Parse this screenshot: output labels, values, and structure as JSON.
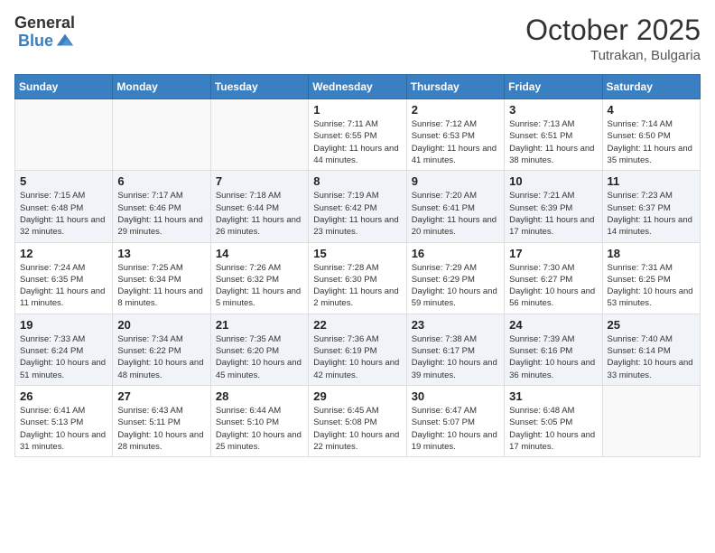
{
  "header": {
    "logo_general": "General",
    "logo_blue": "Blue",
    "month": "October 2025",
    "location": "Tutrakan, Bulgaria"
  },
  "days_of_week": [
    "Sunday",
    "Monday",
    "Tuesday",
    "Wednesday",
    "Thursday",
    "Friday",
    "Saturday"
  ],
  "weeks": [
    [
      {
        "day": "",
        "info": ""
      },
      {
        "day": "",
        "info": ""
      },
      {
        "day": "",
        "info": ""
      },
      {
        "day": "1",
        "info": "Sunrise: 7:11 AM\nSunset: 6:55 PM\nDaylight: 11 hours and 44 minutes."
      },
      {
        "day": "2",
        "info": "Sunrise: 7:12 AM\nSunset: 6:53 PM\nDaylight: 11 hours and 41 minutes."
      },
      {
        "day": "3",
        "info": "Sunrise: 7:13 AM\nSunset: 6:51 PM\nDaylight: 11 hours and 38 minutes."
      },
      {
        "day": "4",
        "info": "Sunrise: 7:14 AM\nSunset: 6:50 PM\nDaylight: 11 hours and 35 minutes."
      }
    ],
    [
      {
        "day": "5",
        "info": "Sunrise: 7:15 AM\nSunset: 6:48 PM\nDaylight: 11 hours and 32 minutes."
      },
      {
        "day": "6",
        "info": "Sunrise: 7:17 AM\nSunset: 6:46 PM\nDaylight: 11 hours and 29 minutes."
      },
      {
        "day": "7",
        "info": "Sunrise: 7:18 AM\nSunset: 6:44 PM\nDaylight: 11 hours and 26 minutes."
      },
      {
        "day": "8",
        "info": "Sunrise: 7:19 AM\nSunset: 6:42 PM\nDaylight: 11 hours and 23 minutes."
      },
      {
        "day": "9",
        "info": "Sunrise: 7:20 AM\nSunset: 6:41 PM\nDaylight: 11 hours and 20 minutes."
      },
      {
        "day": "10",
        "info": "Sunrise: 7:21 AM\nSunset: 6:39 PM\nDaylight: 11 hours and 17 minutes."
      },
      {
        "day": "11",
        "info": "Sunrise: 7:23 AM\nSunset: 6:37 PM\nDaylight: 11 hours and 14 minutes."
      }
    ],
    [
      {
        "day": "12",
        "info": "Sunrise: 7:24 AM\nSunset: 6:35 PM\nDaylight: 11 hours and 11 minutes."
      },
      {
        "day": "13",
        "info": "Sunrise: 7:25 AM\nSunset: 6:34 PM\nDaylight: 11 hours and 8 minutes."
      },
      {
        "day": "14",
        "info": "Sunrise: 7:26 AM\nSunset: 6:32 PM\nDaylight: 11 hours and 5 minutes."
      },
      {
        "day": "15",
        "info": "Sunrise: 7:28 AM\nSunset: 6:30 PM\nDaylight: 11 hours and 2 minutes."
      },
      {
        "day": "16",
        "info": "Sunrise: 7:29 AM\nSunset: 6:29 PM\nDaylight: 10 hours and 59 minutes."
      },
      {
        "day": "17",
        "info": "Sunrise: 7:30 AM\nSunset: 6:27 PM\nDaylight: 10 hours and 56 minutes."
      },
      {
        "day": "18",
        "info": "Sunrise: 7:31 AM\nSunset: 6:25 PM\nDaylight: 10 hours and 53 minutes."
      }
    ],
    [
      {
        "day": "19",
        "info": "Sunrise: 7:33 AM\nSunset: 6:24 PM\nDaylight: 10 hours and 51 minutes."
      },
      {
        "day": "20",
        "info": "Sunrise: 7:34 AM\nSunset: 6:22 PM\nDaylight: 10 hours and 48 minutes."
      },
      {
        "day": "21",
        "info": "Sunrise: 7:35 AM\nSunset: 6:20 PM\nDaylight: 10 hours and 45 minutes."
      },
      {
        "day": "22",
        "info": "Sunrise: 7:36 AM\nSunset: 6:19 PM\nDaylight: 10 hours and 42 minutes."
      },
      {
        "day": "23",
        "info": "Sunrise: 7:38 AM\nSunset: 6:17 PM\nDaylight: 10 hours and 39 minutes."
      },
      {
        "day": "24",
        "info": "Sunrise: 7:39 AM\nSunset: 6:16 PM\nDaylight: 10 hours and 36 minutes."
      },
      {
        "day": "25",
        "info": "Sunrise: 7:40 AM\nSunset: 6:14 PM\nDaylight: 10 hours and 33 minutes."
      }
    ],
    [
      {
        "day": "26",
        "info": "Sunrise: 6:41 AM\nSunset: 5:13 PM\nDaylight: 10 hours and 31 minutes."
      },
      {
        "day": "27",
        "info": "Sunrise: 6:43 AM\nSunset: 5:11 PM\nDaylight: 10 hours and 28 minutes."
      },
      {
        "day": "28",
        "info": "Sunrise: 6:44 AM\nSunset: 5:10 PM\nDaylight: 10 hours and 25 minutes."
      },
      {
        "day": "29",
        "info": "Sunrise: 6:45 AM\nSunset: 5:08 PM\nDaylight: 10 hours and 22 minutes."
      },
      {
        "day": "30",
        "info": "Sunrise: 6:47 AM\nSunset: 5:07 PM\nDaylight: 10 hours and 19 minutes."
      },
      {
        "day": "31",
        "info": "Sunrise: 6:48 AM\nSunset: 5:05 PM\nDaylight: 10 hours and 17 minutes."
      },
      {
        "day": "",
        "info": ""
      }
    ]
  ]
}
